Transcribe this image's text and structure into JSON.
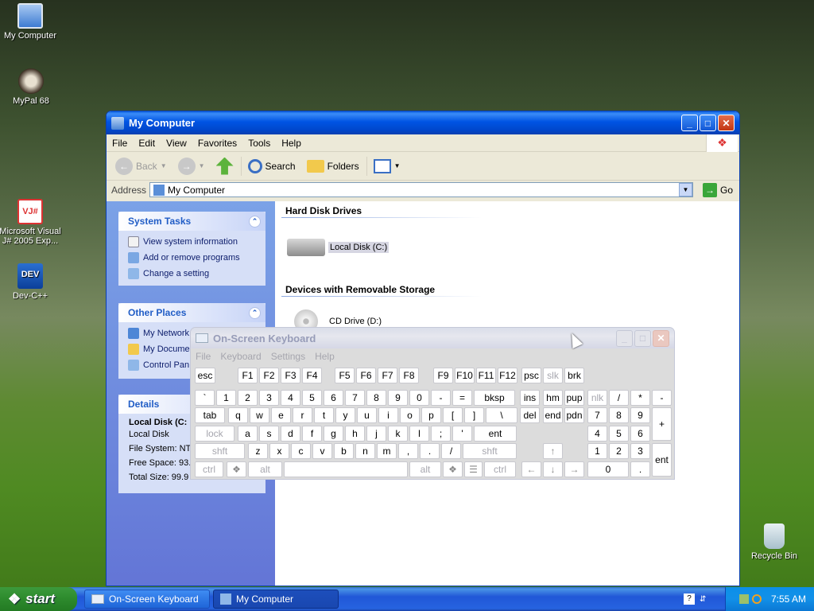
{
  "desktop": {
    "icons": [
      {
        "label": "My Computer",
        "icon": "computer-icon"
      },
      {
        "label": "MyPal 68",
        "icon": "raccoon-icon"
      },
      {
        "label": "Microsoft Visual J# 2005 Exp...",
        "icon": "vj-icon"
      },
      {
        "label": "Dev-C++",
        "icon": "dev-icon"
      },
      {
        "label": "Recycle Bin",
        "icon": "recycle-bin-icon"
      }
    ]
  },
  "mycomputer": {
    "title": "My Computer",
    "menu": [
      "File",
      "Edit",
      "View",
      "Favorites",
      "Tools",
      "Help"
    ],
    "toolbar": {
      "back": "Back",
      "search": "Search",
      "folders": "Folders"
    },
    "address": {
      "label": "Address",
      "value": "My Computer",
      "go": "Go"
    },
    "system_tasks": {
      "title": "System Tasks",
      "items": [
        "View system information",
        "Add or remove programs",
        "Change a setting"
      ]
    },
    "other_places": {
      "title": "Other Places",
      "items": [
        "My Network",
        "My Docume",
        "Control Pan"
      ]
    },
    "details": {
      "title": "Details",
      "name": "Local Disk (C:",
      "type": "Local Disk",
      "fs": "File System: NTI",
      "free": "Free Space: 93.",
      "total": "Total Size: 99.9 GB"
    },
    "groups": [
      {
        "title": "Hard Disk Drives",
        "item": "Local Disk (C:)"
      },
      {
        "title": "Devices with Removable Storage",
        "item": "CD Drive (D:)"
      }
    ]
  },
  "osk": {
    "title": "On-Screen Keyboard",
    "menu": [
      "File",
      "Keyboard",
      "Settings",
      "Help"
    ],
    "rows": {
      "fn": [
        "esc",
        "F1",
        "F2",
        "F3",
        "F4",
        "F5",
        "F6",
        "F7",
        "F8",
        "F9",
        "F10",
        "F11",
        "F12",
        "psc",
        "slk",
        "brk"
      ],
      "num": [
        "`",
        "1",
        "2",
        "3",
        "4",
        "5",
        "6",
        "7",
        "8",
        "9",
        "0",
        "-",
        "=",
        "bksp",
        "ins",
        "hm",
        "pup",
        "nlk",
        "/",
        "*",
        "-"
      ],
      "top": [
        "tab",
        "q",
        "w",
        "e",
        "r",
        "t",
        "y",
        "u",
        "i",
        "o",
        "p",
        "[",
        "]",
        "\\",
        "del",
        "end",
        "pdn",
        "7",
        "8",
        "9",
        "+"
      ],
      "home": [
        "lock",
        "a",
        "s",
        "d",
        "f",
        "g",
        "h",
        "j",
        "k",
        "l",
        ";",
        "'",
        "ent",
        "4",
        "5",
        "6"
      ],
      "bot": [
        "shft",
        "z",
        "x",
        "c",
        "v",
        "b",
        "n",
        "m",
        ",",
        ".",
        "/",
        "shft",
        "1",
        "2",
        "3",
        "ent"
      ],
      "sp": [
        "ctrl",
        "alt",
        "alt",
        "ctrl",
        "0",
        "."
      ]
    }
  },
  "taskbar": {
    "start": "start",
    "tasks": [
      "On-Screen Keyboard",
      "My Computer"
    ],
    "time": "7:55 AM"
  }
}
